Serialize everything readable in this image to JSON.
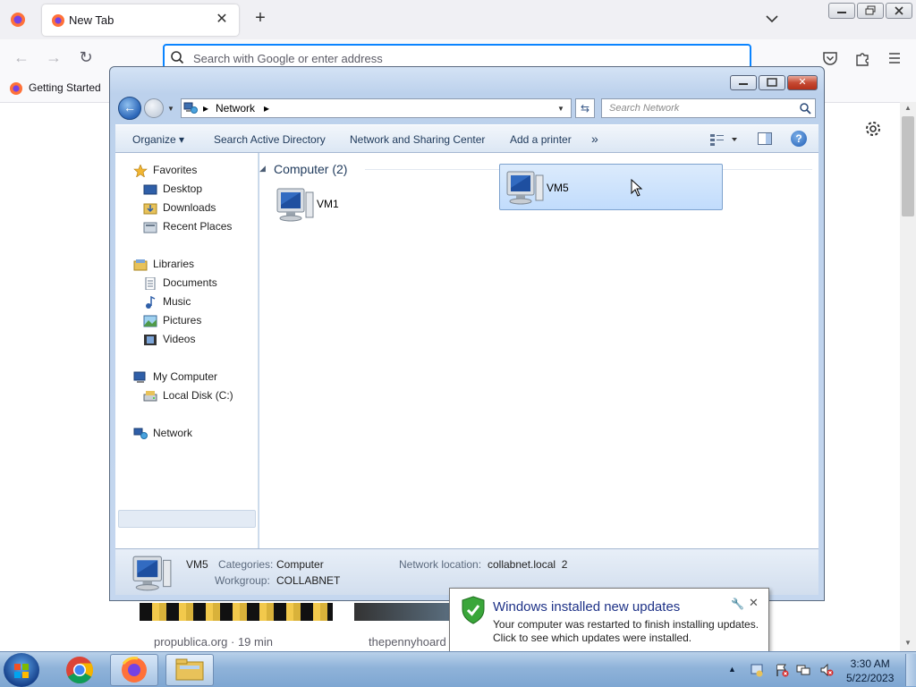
{
  "browser": {
    "tab_title": "New Tab",
    "url_placeholder": "Search with Google or enter address",
    "bookmark_label": "Getting Started",
    "cards": [
      {
        "source": "propublica.org · 19 min"
      },
      {
        "source": "thepennyhoard"
      }
    ]
  },
  "explorer": {
    "address": {
      "crumb": "Network"
    },
    "search_placeholder": "Search Network",
    "commands": {
      "organize": "Organize",
      "search_ad": "Search Active Directory",
      "network_center": "Network and Sharing Center",
      "add_printer": "Add a printer",
      "more": "»"
    },
    "nav": {
      "favorites": "Favorites",
      "desktop": "Desktop",
      "downloads": "Downloads",
      "recent": "Recent Places",
      "libraries": "Libraries",
      "documents": "Documents",
      "music": "Music",
      "pictures": "Pictures",
      "videos": "Videos",
      "my_computer": "My Computer",
      "local_disk": "Local Disk (C:)",
      "network": "Network"
    },
    "group_header": "Computer (2)",
    "items": [
      {
        "label": "VM1"
      },
      {
        "label": "VM5"
      }
    ],
    "details": {
      "name": "VM5",
      "categories_label": "Categories:",
      "categories_value": "Computer",
      "workgroup_label": "Workgroup:",
      "workgroup_value": "COLLABNET",
      "location_label": "Network location:",
      "location_value": "collabnet.local  2"
    }
  },
  "notification": {
    "title": "Windows installed new updates",
    "line1": "Your computer was restarted to finish installing updates.",
    "line2": "Click to see which updates were installed."
  },
  "taskbar": {
    "time": "3:30 AM",
    "date": "5/22/2023"
  },
  "colors": {
    "accent": "#0a84ff",
    "selection": "#c1dcfc",
    "title_blue": "#1e3287"
  }
}
